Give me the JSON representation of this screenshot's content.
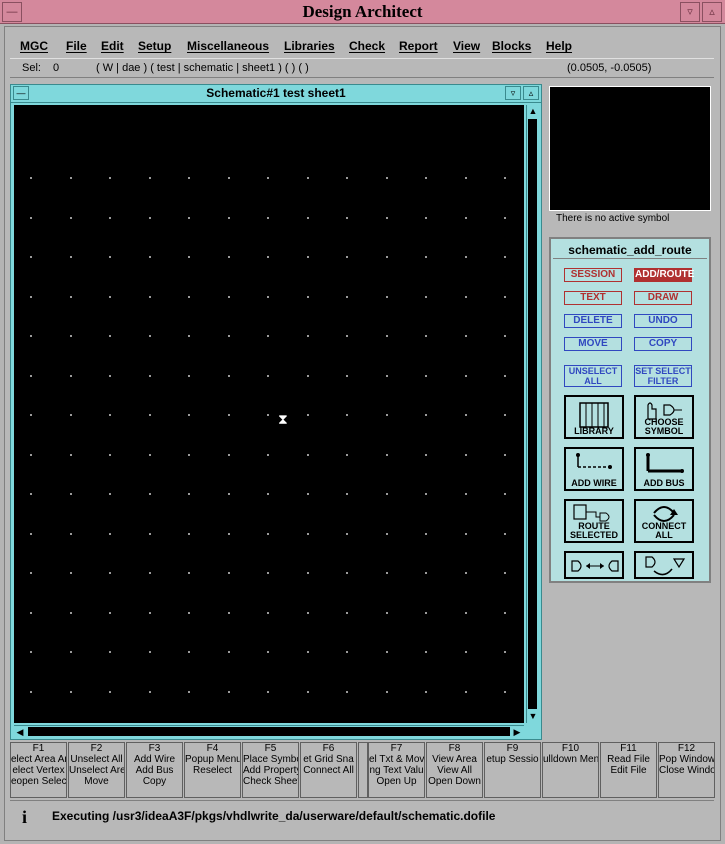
{
  "app": {
    "title": "Design Architect"
  },
  "menu": [
    "MGC",
    "File",
    "Edit",
    "Setup",
    "Miscellaneous",
    "Libraries",
    "Check",
    "Report",
    "View",
    "Blocks",
    "Help"
  ],
  "status": {
    "sel_label": "Sel:",
    "sel_count": "0",
    "context": "( W | dae ) ( test | schematic | sheet1 ) ( ) ( )",
    "coords": "(0.0505, -0.0505)"
  },
  "schematic": {
    "title": "Schematic#1 test sheet1"
  },
  "preview": {
    "label": "There is no active symbol"
  },
  "palette": {
    "title": "schematic_add_route",
    "buttons": [
      {
        "label": "SESSION",
        "color": "#b03030"
      },
      {
        "label": "ADD/ROUTE",
        "color": "#b03030",
        "active": true
      },
      {
        "label": "TEXT",
        "color": "#b03030"
      },
      {
        "label": "DRAW",
        "color": "#b03030"
      },
      {
        "label": "DELETE",
        "color": "#3048c0"
      },
      {
        "label": "UNDO",
        "color": "#3048c0"
      },
      {
        "label": "MOVE",
        "color": "#3048c0"
      },
      {
        "label": "COPY",
        "color": "#3048c0"
      },
      {
        "label": "UNSELECT ALL",
        "color": "#3048c0"
      },
      {
        "label": "SET SELECT FILTER",
        "color": "#3048c0"
      }
    ],
    "icons": [
      {
        "label": "LIBRARY",
        "icon": "library-icon"
      },
      {
        "label": "CHOOSE SYMBOL",
        "icon": "choose-symbol-icon"
      },
      {
        "label": "ADD WIRE",
        "icon": "add-wire-icon"
      },
      {
        "label": "ADD BUS",
        "icon": "add-bus-icon"
      },
      {
        "label": "ROUTE SELECTED",
        "icon": "route-selected-icon"
      },
      {
        "label": "CONNECT ALL",
        "icon": "connect-all-icon"
      },
      {
        "label": "",
        "icon": "connect-symbols-icon"
      },
      {
        "label": "",
        "icon": "rotate-symbol-icon"
      }
    ]
  },
  "fkeys": [
    {
      "key": "F1",
      "lines": [
        "elect Area An",
        "elect Vertex",
        "eopen Selec"
      ]
    },
    {
      "key": "F2",
      "lines": [
        "Unselect All",
        "Unselect Are",
        "Move"
      ]
    },
    {
      "key": "F3",
      "lines": [
        "Add Wire",
        "Add Bus",
        "Copy"
      ]
    },
    {
      "key": "F4",
      "lines": [
        "Popup Menu",
        "",
        "Reselect"
      ]
    },
    {
      "key": "F5",
      "lines": [
        "Place Symbo",
        "Add Property",
        "Check Sheet"
      ]
    },
    {
      "key": "F6",
      "lines": [
        "et Grid Sna",
        "Connect All",
        ""
      ]
    },
    {
      "key": "F7",
      "lines": [
        "el Txt & Mov",
        "ng Text Valu",
        "Open Up"
      ]
    },
    {
      "key": "F8",
      "lines": [
        "View Area",
        "View All",
        "Open Down"
      ]
    },
    {
      "key": "F9",
      "lines": [
        "etup Sessio",
        "",
        ""
      ]
    },
    {
      "key": "F10",
      "lines": [
        "ulldown Men",
        "",
        ""
      ]
    },
    {
      "key": "F11",
      "lines": [
        "Read File",
        "Edit File",
        ""
      ]
    },
    {
      "key": "F12",
      "lines": [
        "Pop Window",
        "Close Window",
        ""
      ]
    }
  ],
  "message": {
    "icon": "info-icon",
    "text": "Executing /usr3/ideaA3F/pkgs/vhdlwrite_da/userware/default/schematic.dofile"
  }
}
